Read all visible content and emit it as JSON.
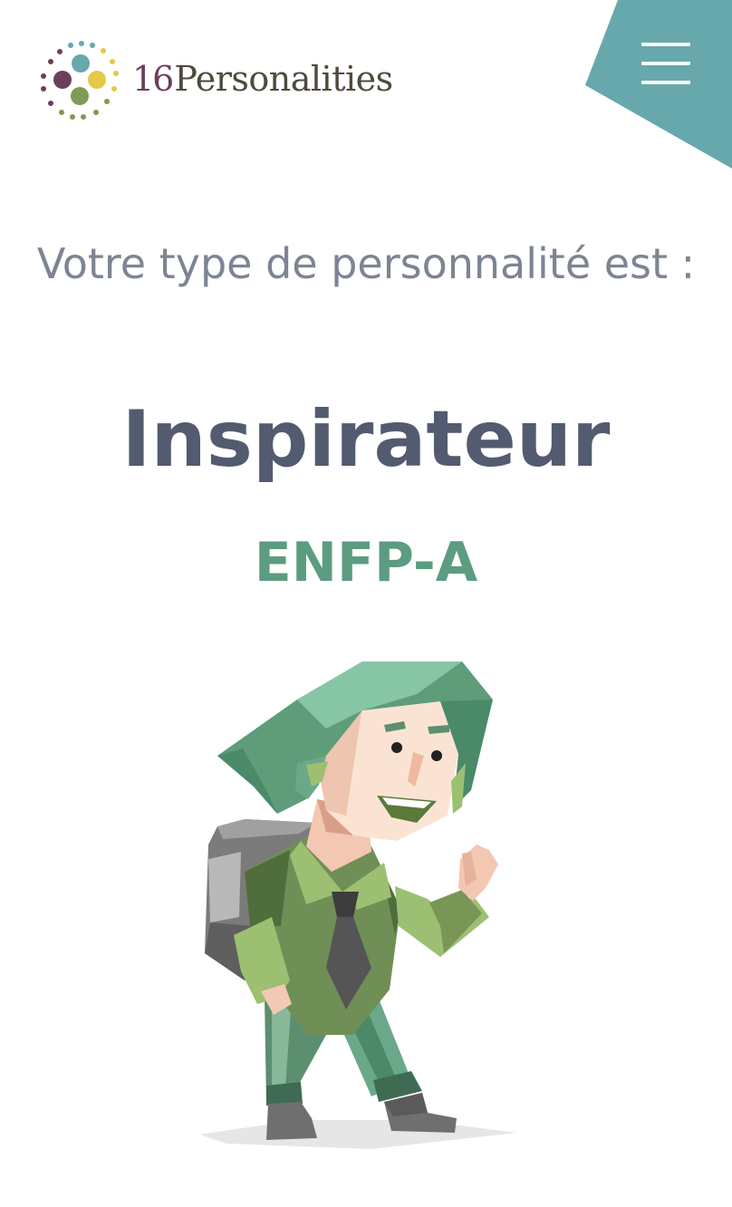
{
  "header": {
    "logo_number": "16",
    "logo_word": "Personalities",
    "menu_icon": "hamburger-menu-icon"
  },
  "result": {
    "intro_text": "Votre type de personnalité est :",
    "type_name": "Inspirateur",
    "type_code": "ENFP-A"
  },
  "illustration": {
    "subject": "enfp-adventurer-character"
  },
  "colors": {
    "menu_corner": "#67a8ad",
    "title": "#525b6f",
    "type_code": "#5c9c80",
    "intro": "#7d8593",
    "logo_number": "#6b3f5a",
    "logo_word": "#4e4a3c"
  }
}
